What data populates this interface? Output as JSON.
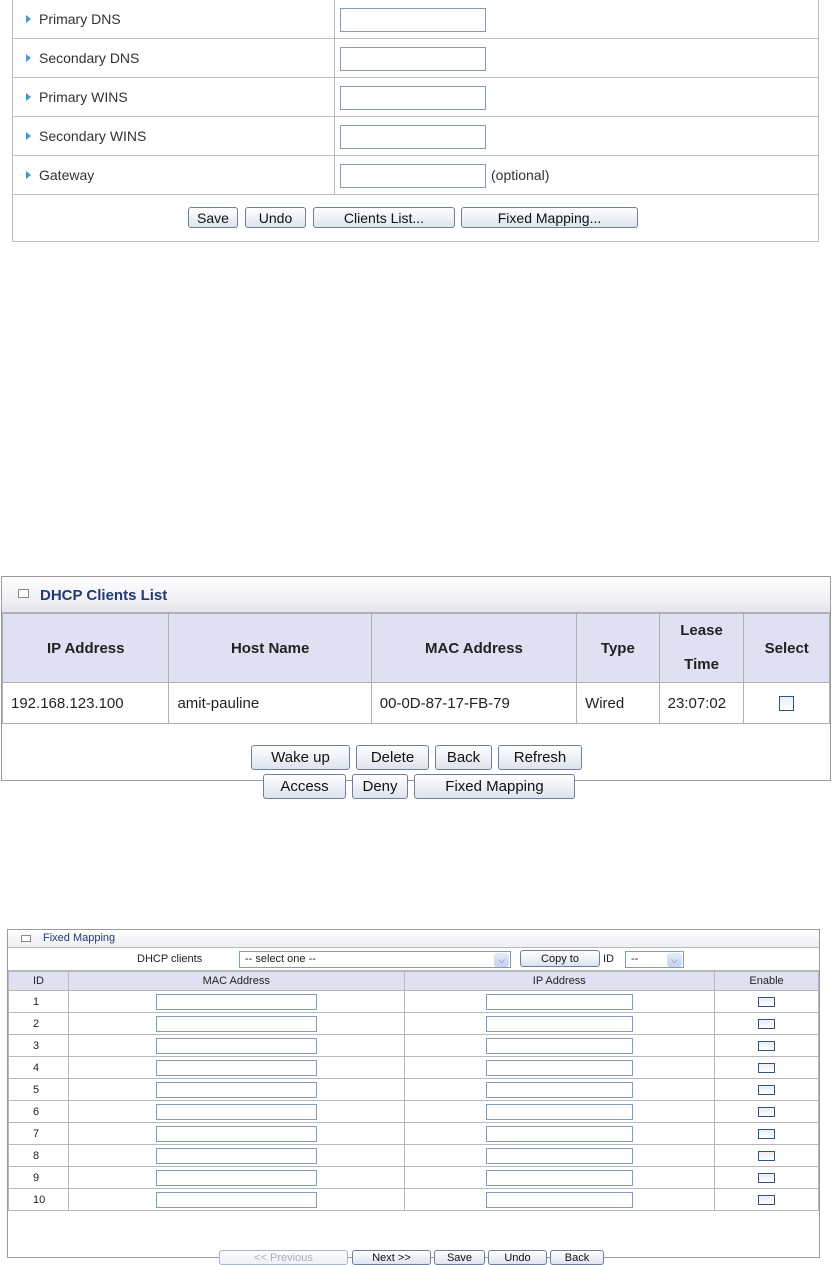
{
  "lan": {
    "rows": [
      {
        "label": "Primary DNS",
        "value": "",
        "note": ""
      },
      {
        "label": "Secondary DNS",
        "value": "",
        "note": ""
      },
      {
        "label": "Primary WINS",
        "value": "",
        "note": ""
      },
      {
        "label": "Secondary WINS",
        "value": "",
        "note": ""
      },
      {
        "label": "Gateway",
        "value": "",
        "note": "(optional)"
      }
    ],
    "buttons": {
      "save": "Save",
      "undo": "Undo",
      "clients": "Clients List...",
      "fixed": "Fixed Mapping..."
    }
  },
  "clients": {
    "title": "DHCP Clients List",
    "headers": {
      "ip": "IP Address",
      "host": "Host Name",
      "mac": "MAC Address",
      "type": "Type",
      "lease_line1": "Lease",
      "lease_line2": "Time",
      "select": "Select"
    },
    "rows": [
      {
        "ip": "192.168.123.100",
        "host": "amit-pauline",
        "mac": "00-0D-87-17-FB-79",
        "type": "Wired",
        "lease": "23:07:02",
        "selected": false
      }
    ],
    "buttons": {
      "wake": "Wake up",
      "delete": "Delete",
      "back": "Back",
      "refresh": "Refresh",
      "access": "Access",
      "deny": "Deny",
      "fixed": "Fixed Mapping"
    }
  },
  "mapping": {
    "title": "Fixed Mapping",
    "dhcp_label": "DHCP clients",
    "dhcp_selected": "-- select one --",
    "copy_to": "Copy to",
    "id_label": "ID",
    "id_selected": "--",
    "headers": {
      "id": "ID",
      "mac": "MAC Address",
      "ip": "IP Address",
      "enable": "Enable"
    },
    "rows": [
      {
        "id": "1",
        "mac": "",
        "ip": "",
        "enabled": false
      },
      {
        "id": "2",
        "mac": "",
        "ip": "",
        "enabled": false
      },
      {
        "id": "3",
        "mac": "",
        "ip": "",
        "enabled": false
      },
      {
        "id": "4",
        "mac": "",
        "ip": "",
        "enabled": false
      },
      {
        "id": "5",
        "mac": "",
        "ip": "",
        "enabled": false
      },
      {
        "id": "6",
        "mac": "",
        "ip": "",
        "enabled": false
      },
      {
        "id": "7",
        "mac": "",
        "ip": "",
        "enabled": false
      },
      {
        "id": "8",
        "mac": "",
        "ip": "",
        "enabled": false
      },
      {
        "id": "9",
        "mac": "",
        "ip": "",
        "enabled": false
      },
      {
        "id": "10",
        "mac": "",
        "ip": "",
        "enabled": false
      }
    ],
    "buttons": {
      "previous": "<< Previous",
      "next": "Next >>",
      "save": "Save",
      "undo": "Undo",
      "back": "Back"
    }
  }
}
